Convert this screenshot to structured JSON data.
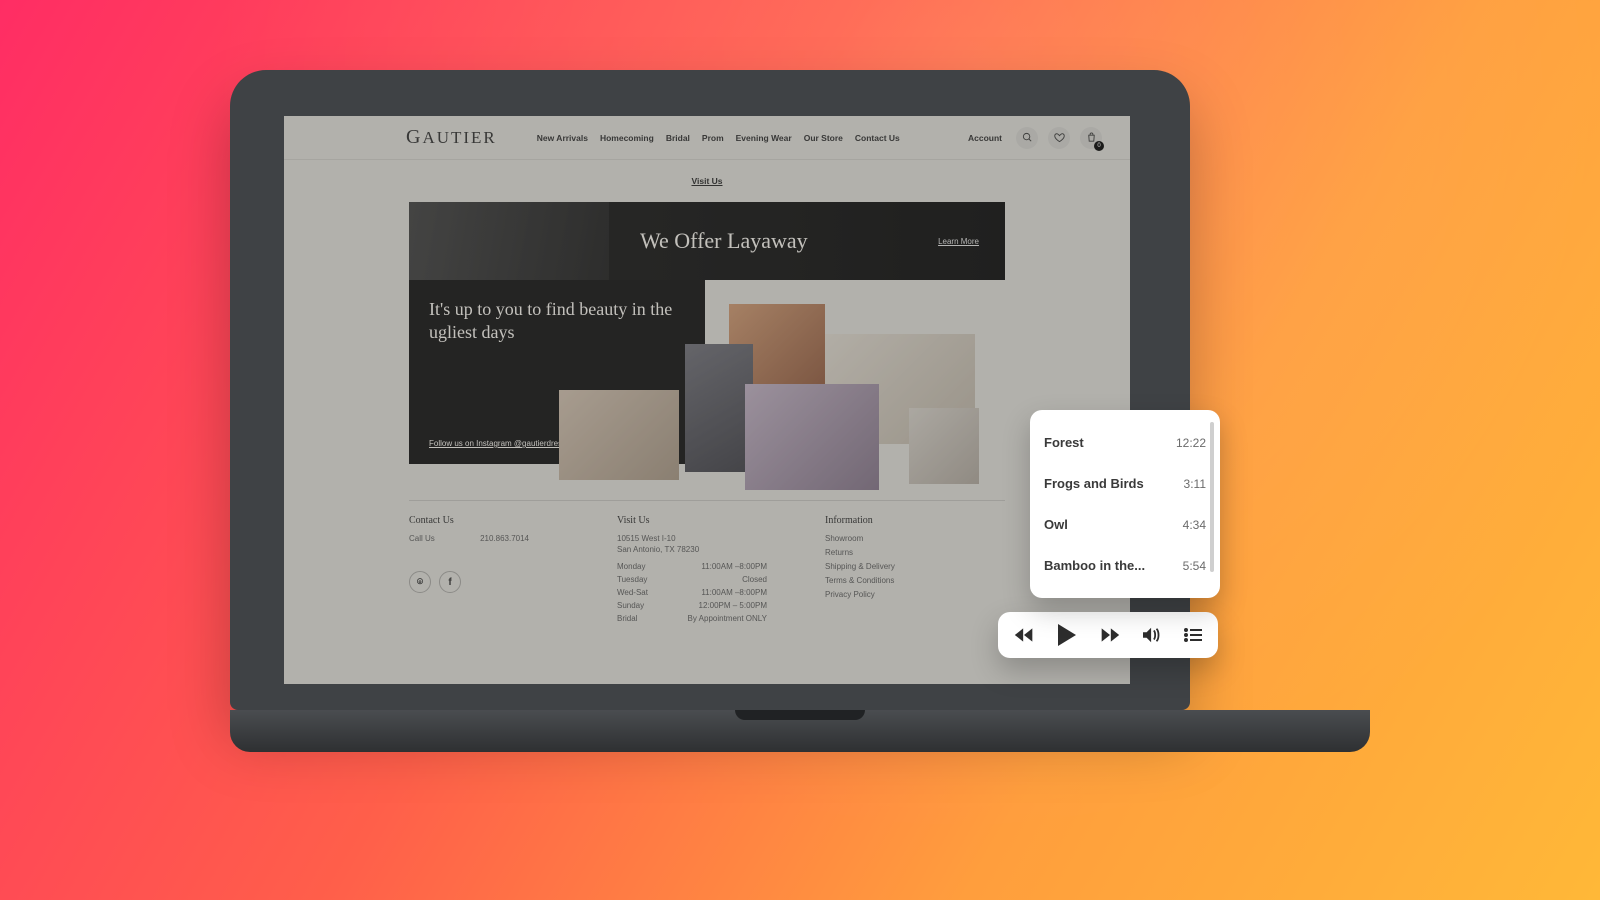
{
  "site": {
    "brand": "GAUTIER",
    "nav": [
      "New Arrivals",
      "Homecoming",
      "Bridal",
      "Prom",
      "Evening Wear",
      "Our Store",
      "Contact Us"
    ],
    "account": "Account",
    "bag_count": "0",
    "visit_us": "Visit Us"
  },
  "banner": {
    "headline": "We Offer Layaway",
    "cta": "Learn More"
  },
  "quote": {
    "text": "It's up to you to find beauty in the ugliest days",
    "follow": "Follow us on Instagram @gautierdresses"
  },
  "footer": {
    "contact": {
      "title": "Contact Us",
      "call_label": "Call Us",
      "phone": "210.863.7014"
    },
    "visit": {
      "title": "Visit Us",
      "addr1": "10515 West I-10",
      "addr2": "San Antonio, TX 78230",
      "hours": [
        {
          "d": "Monday",
          "h": "11:00AM –8:00PM"
        },
        {
          "d": "Tuesday",
          "h": "Closed"
        },
        {
          "d": "Wed-Sat",
          "h": "11:00AM –8:00PM"
        },
        {
          "d": "Sunday",
          "h": "12:00PM – 5:00PM"
        },
        {
          "d": "Bridal",
          "h": "By Appointment ONLY"
        }
      ]
    },
    "info": {
      "title": "Information",
      "links": [
        "Showroom",
        "Returns",
        "Shipping & Delivery",
        "Terms & Conditions",
        "Privacy Policy"
      ]
    }
  },
  "player": {
    "tracks": [
      {
        "title": "Forest",
        "duration": "12:22"
      },
      {
        "title": "Frogs and Birds",
        "duration": "3:11"
      },
      {
        "title": "Owl",
        "duration": "4:34"
      },
      {
        "title": "Bamboo in the...",
        "duration": "5:54"
      }
    ]
  }
}
